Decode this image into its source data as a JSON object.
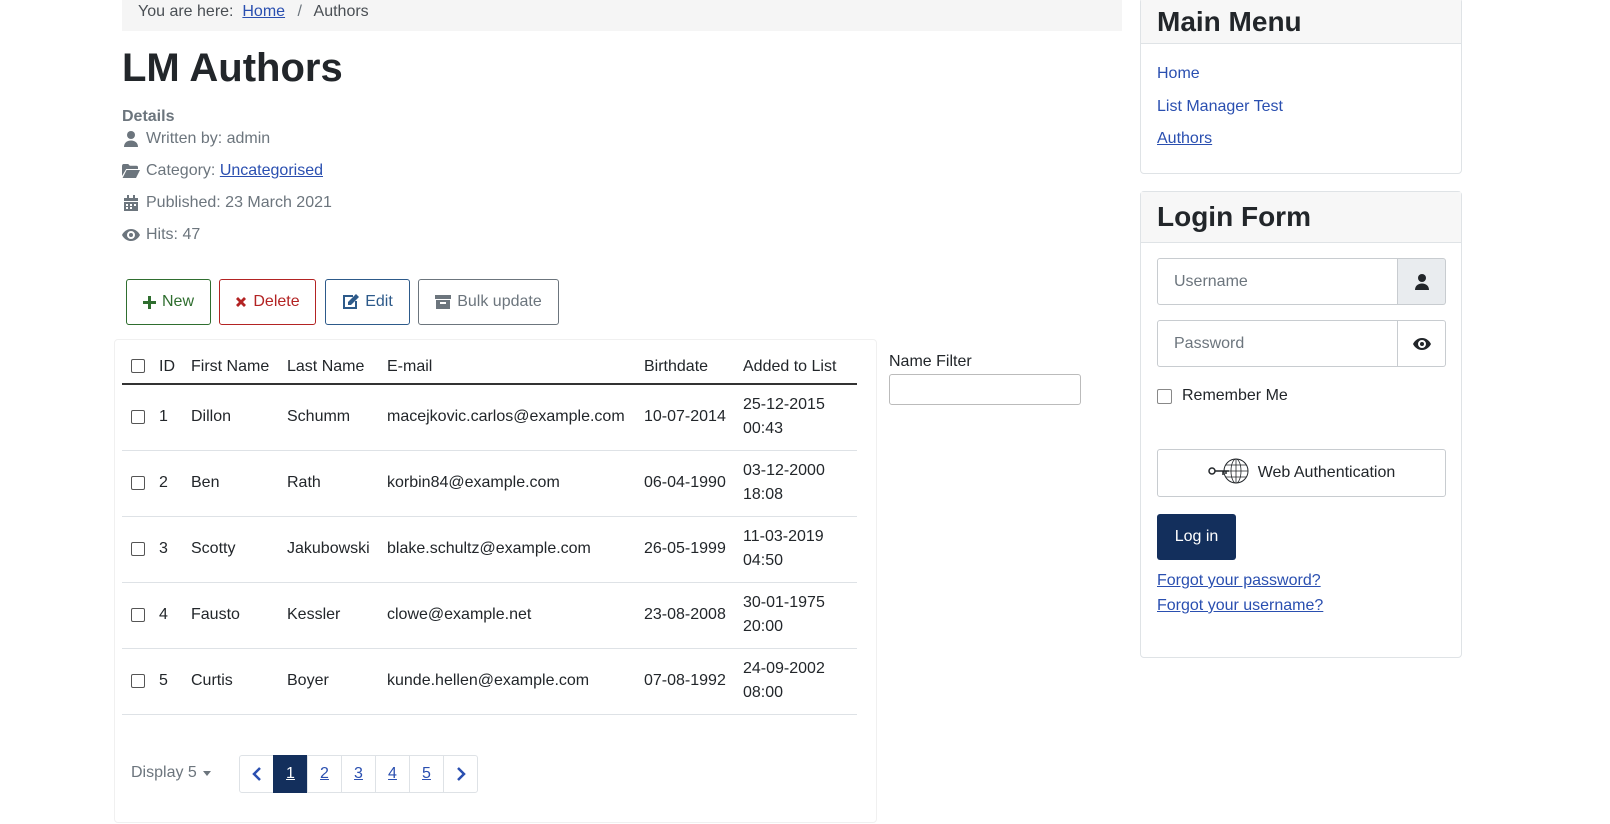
{
  "breadcrumb": {
    "prefix": "You are here:",
    "home": "Home",
    "separator": "/",
    "current": "Authors"
  },
  "article": {
    "title": "LM Authors",
    "details_label": "Details",
    "written_by": "Written by: admin",
    "category_prefix": "Category:",
    "category": "Uncategorised",
    "published": "Published: 23 March 2021",
    "hits": "Hits: 47"
  },
  "toolbar": {
    "new_label": "New",
    "delete_label": "Delete",
    "edit_label": "Edit",
    "bulk_label": "Bulk update"
  },
  "table": {
    "headers": {
      "id": "ID",
      "first_name": "First Name",
      "last_name": "Last Name",
      "email": "E-mail",
      "birthdate": "Birthdate",
      "added": "Added to List"
    },
    "rows": [
      {
        "id": "1",
        "first": "Dillon",
        "last": "Schumm",
        "email": "macejkovic.carlos@example.com",
        "birth": "10-07-2014",
        "added_date": "25-12-2015",
        "added_time": "00:43"
      },
      {
        "id": "2",
        "first": "Ben",
        "last": "Rath",
        "email": "korbin84@example.com",
        "birth": "06-04-1990",
        "added_date": "03-12-2000",
        "added_time": "18:08"
      },
      {
        "id": "3",
        "first": "Scotty",
        "last": "Jakubowski",
        "email": "blake.schultz@example.com",
        "birth": "26-05-1999",
        "added_date": "11-03-2019",
        "added_time": "04:50"
      },
      {
        "id": "4",
        "first": "Fausto",
        "last": "Kessler",
        "email": "clowe@example.net",
        "birth": "23-08-2008",
        "added_date": "30-01-1975",
        "added_time": "20:00"
      },
      {
        "id": "5",
        "first": "Curtis",
        "last": "Boyer",
        "email": "kunde.hellen@example.com",
        "birth": "07-08-1992",
        "added_date": "24-09-2002",
        "added_time": "08:00"
      }
    ]
  },
  "filter": {
    "label": "Name Filter",
    "value": ""
  },
  "pagination": {
    "display_label": "Display 5",
    "pages": [
      "1",
      "2",
      "3",
      "4",
      "5"
    ],
    "active_page": "1",
    "prev_icon": "chevron-left-icon",
    "next_icon": "chevron-right-icon"
  },
  "main_menu": {
    "title": "Main Menu",
    "items": [
      "Home",
      "List Manager Test",
      "Authors"
    ],
    "current": "Authors"
  },
  "login": {
    "title": "Login Form",
    "username_placeholder": "Username",
    "password_placeholder": "Password",
    "remember_label": "Remember Me",
    "webauthn_label": "Web Authentication",
    "login_label": "Log in",
    "forgot_password": "Forgot your password?",
    "forgot_username": "Forgot your username?"
  },
  "colors": {
    "primary_dark": "#132f5c",
    "link": "#2a4fb0",
    "success": "#2f6e2f",
    "danger": "#b32323",
    "info": "#2d5a8a",
    "muted": "#6c757d"
  }
}
